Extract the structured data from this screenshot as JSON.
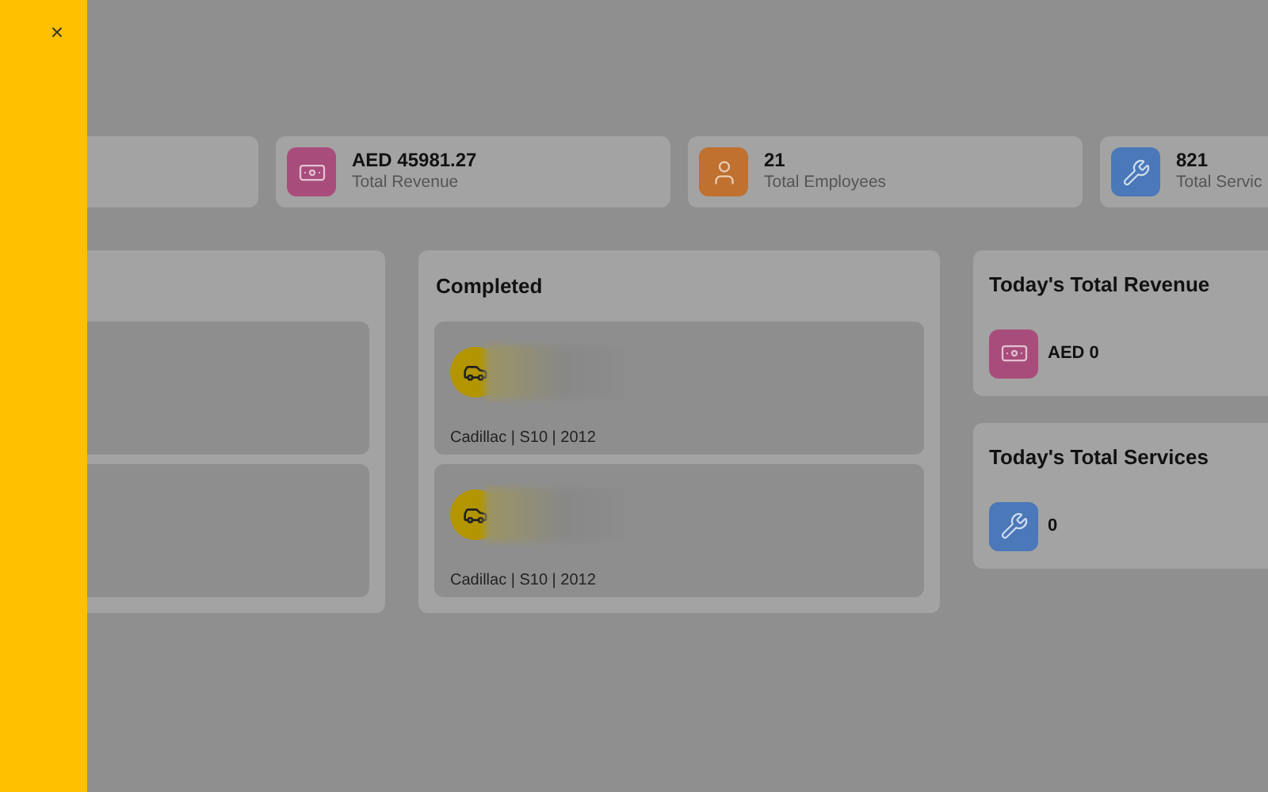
{
  "drawer": {
    "close": "×"
  },
  "stats": [
    {
      "kind": "blank"
    },
    {
      "kind": "money",
      "value": "AED 45981.27",
      "label": "Total Revenue"
    },
    {
      "kind": "people",
      "value": "21",
      "label": "Total Employees"
    },
    {
      "kind": "service",
      "value": "821",
      "label": "Total Servic"
    }
  ],
  "columns": [
    {
      "jobs": [
        {
          "kind": "blank"
        },
        {
          "kind": "blank"
        }
      ]
    },
    {
      "title": "Completed",
      "jobs": [
        {
          "kind": "vehicle",
          "vehicle": "Cadillac | S10 | 2012"
        },
        {
          "kind": "vehicle",
          "vehicle": "Cadillac | S10 | 2012"
        }
      ]
    }
  ],
  "today": [
    {
      "kind": "money",
      "title": "Today's Total Revenue",
      "value": "AED 0"
    },
    {
      "kind": "service",
      "title": "Today's Total Services",
      "value": "0"
    }
  ]
}
